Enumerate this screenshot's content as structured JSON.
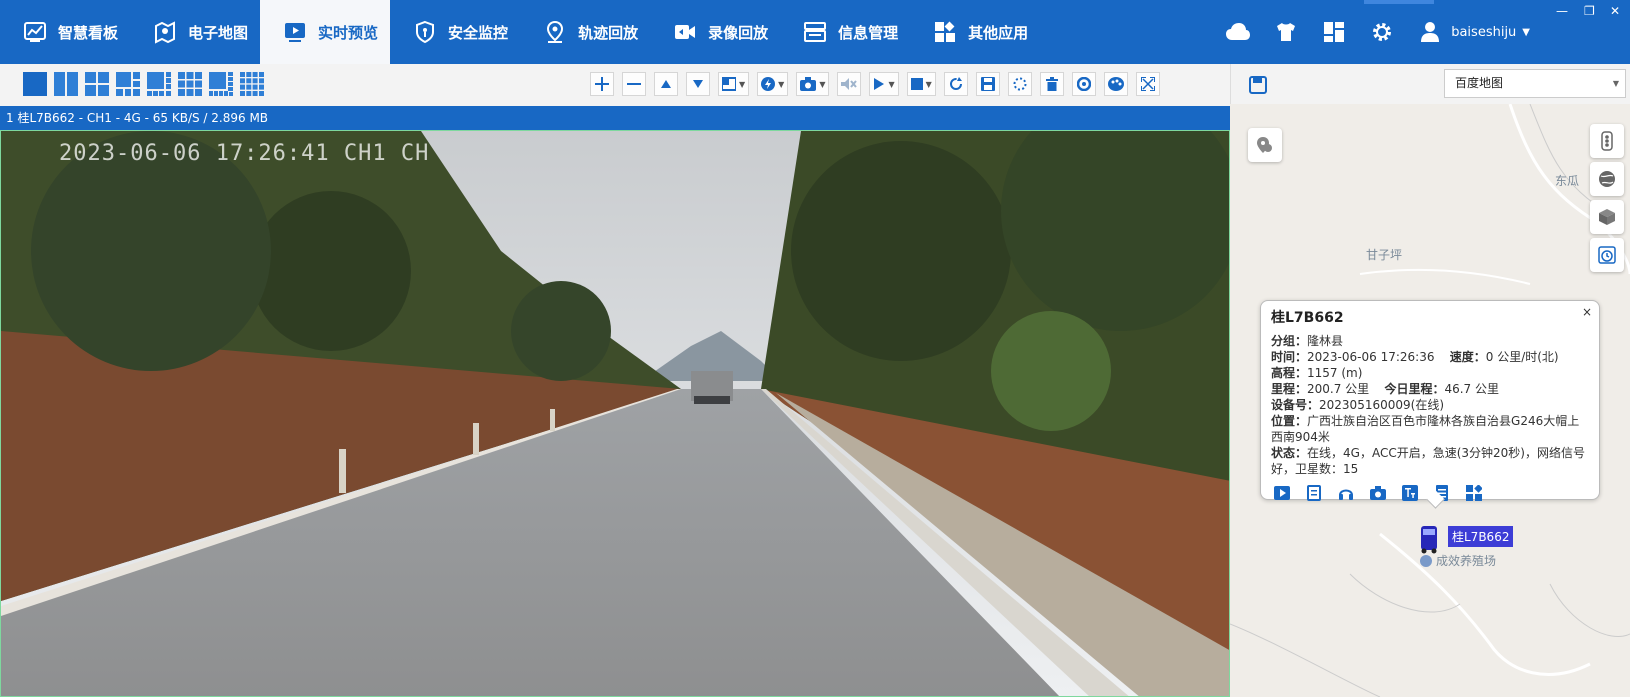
{
  "nav": {
    "items": [
      {
        "label": "智慧看板",
        "icon": "dashboard-icon"
      },
      {
        "label": "电子地图",
        "icon": "map-icon"
      },
      {
        "label": "实时预览",
        "icon": "live-preview-icon"
      },
      {
        "label": "安全监控",
        "icon": "shield-icon"
      },
      {
        "label": "轨迹回放",
        "icon": "track-icon"
      },
      {
        "label": "录像回放",
        "icon": "video-playback-icon"
      },
      {
        "label": "信息管理",
        "icon": "info-manage-icon"
      },
      {
        "label": "其他应用",
        "icon": "apps-icon"
      }
    ],
    "active": "实时预览",
    "username": "baiseshiju",
    "user_caret": "▼"
  },
  "window": {
    "minimize": "—",
    "restore": "❐",
    "close": "✕"
  },
  "video": {
    "header": "1 桂L7B662 - CH1 - 4G - 65 KB/S / 2.896 MB",
    "osd": "2023-06-06 17:26:41 CH1   CH"
  },
  "map": {
    "provider": "百度地图",
    "labels": {
      "east": "东瓜",
      "place": "甘子坪",
      "poi": "成效养殖场"
    },
    "vehicle_label": "桂L7B662"
  },
  "popup": {
    "title": "桂L7B662",
    "close": "×",
    "group_key": "分组：",
    "group_val": "隆林县",
    "time_key": "时间：",
    "time_val": "2023-06-06 17:26:36",
    "speed_key": "速度：",
    "speed_val": "0 公里/时(北)",
    "alt_key": "高程：",
    "alt_val": "1157 (m)",
    "mile_key": "里程：",
    "mile_val": "200.7 公里",
    "today_key": "今日里程：",
    "today_val": "46.7 公里",
    "dev_key": "设备号：",
    "dev_val": "202305160009(在线)",
    "pos_key": "位置：",
    "pos_val": "广西壮族自治区百色市隆林各族自治县G246大帽上西南904米",
    "state_key": "状态：",
    "state_val": "在线，4G，ACC开启，急速(3分钟20秒)，网络信号好，卫星数：15"
  },
  "colors": {
    "brand": "#1868c4",
    "active_bg": "#f5f7fa",
    "vehicle": "#3d3dd6"
  }
}
